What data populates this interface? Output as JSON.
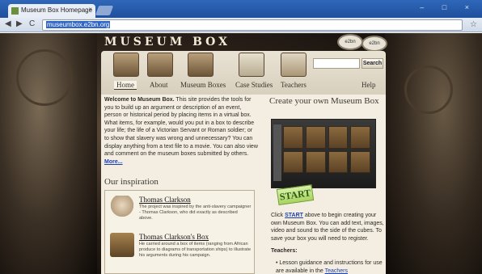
{
  "browser": {
    "tab_title": "Museum Box Homepage",
    "tab_close": "×",
    "url": "museumbox.e2bn.org",
    "back": "◀",
    "forward": "▶",
    "reload": "C",
    "home": "⌂",
    "star": "☆",
    "window_controls": "– □ ×"
  },
  "site": {
    "logo": "MUSEUM BOX",
    "badge_1": "e2bn",
    "badge_2": "e2bn",
    "search": {
      "value": "",
      "button": "Search"
    },
    "nav": [
      {
        "label": "Home"
      },
      {
        "label": "About"
      },
      {
        "label": "Museum Boxes"
      },
      {
        "label": "Case Studies"
      },
      {
        "label": "Teachers"
      },
      {
        "label": "Help"
      }
    ]
  },
  "intro": {
    "bold_lead": "Welcome to Museum Box.",
    "body": " This site provides the tools for you to build up an argument or description of an event, person or historical period by placing items in a virtual box. What items, for example, would you put in a box to describe your life; the life of a Victorian Servant or Roman soldier; or to show that slavery was wrong and unnecessary? You can display anything from a text file to a movie. You can also view and comment on the museum boxes submitted by others. ",
    "more": "More..."
  },
  "inspiration": {
    "heading": "Our inspiration",
    "items": [
      {
        "title": "Thomas Clarkson",
        "desc": "The project was inspired by the anti-slavery campaigner - Thomas Clarkson, who did exactly as described above."
      },
      {
        "title": "Thomas Clarkson's Box",
        "desc": "He carried around a box of items (ranging from African produce to diagrams of transportation ships) to illustrate his arguments during his campaign."
      }
    ]
  },
  "create": {
    "heading": "Create your own Museum Box",
    "start_button": "START",
    "text_pre": "Click ",
    "text_link": "START",
    "text_post": " above to begin creating your own Museum Box. You can add text, images, video and sound to the side of the cubes. To save your box you will need to register.",
    "teachers_heading": "Teachers:",
    "teachers_item_pre": "• Lesson guidance and instructions for use are available in the ",
    "teachers_item_link": "Teachers"
  }
}
